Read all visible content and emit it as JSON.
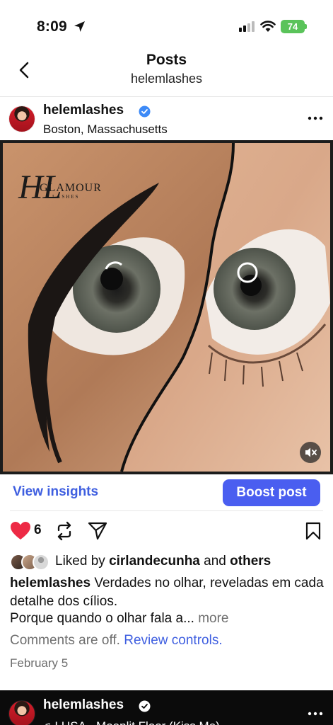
{
  "status_bar": {
    "time": "8:09",
    "battery": "74",
    "icons": [
      "location-arrow-icon",
      "cellular-signal-icon",
      "wifi-icon",
      "battery-icon"
    ]
  },
  "nav": {
    "title": "Posts",
    "subtitle": "helemlashes",
    "back_icon": "chevron-left-icon"
  },
  "post": {
    "username": "helemlashes",
    "location": "Boston, Massachusetts",
    "media": {
      "watermark_logo": "HL GLAMOUR LASHES",
      "mute_icon": "speaker-muted-icon"
    },
    "insights_label": "View insights",
    "boost_label": "Boost post",
    "like_count": "6",
    "liked_prefix": "Liked by",
    "liked_user": "cirlandecunha",
    "liked_and": "and",
    "liked_others": "others",
    "caption_user": "helemlashes",
    "caption_text": "Verdades no olhar, reveladas em cada detalhe dos cílios.",
    "caption_line2": "Porque quando o olhar fala a...",
    "more_label": "more",
    "comments_off": "Comments are off.",
    "review_controls": "Review controls.",
    "date": "February 5",
    "colors": {
      "accent": "#4a5ef0",
      "like": "#ed2a45",
      "verified": "#3d8af7"
    }
  },
  "next_post": {
    "username": "helemlashes",
    "music": "♫ LUSA · Moonlit Floor (Kiss Me)"
  }
}
